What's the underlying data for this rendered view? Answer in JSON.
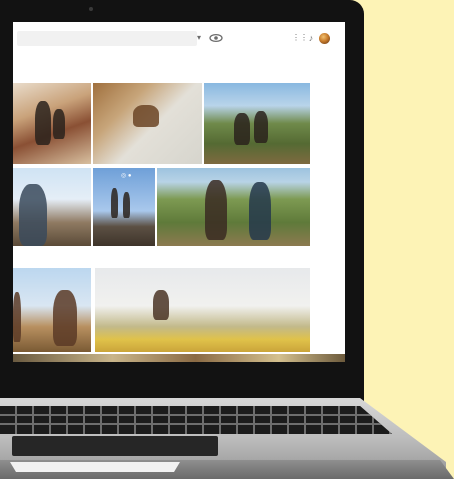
{
  "page": {
    "background": "#fdf3b6",
    "device": "laptop"
  },
  "app": {
    "topbar": {
      "search_placeholder": "",
      "icons": [
        "chevron-down-icon",
        "eye-icon",
        "apps-grid-icon",
        "notifications-icon"
      ],
      "avatar": "user-avatar"
    },
    "photos": [
      {
        "name": "photo-people-posing-rocks"
      },
      {
        "name": "photo-rock-closeup"
      },
      {
        "name": "photo-couple-sitting-hillside"
      },
      {
        "name": "photo-man-pointing-sky"
      },
      {
        "name": "photo-two-people-on-rock"
      },
      {
        "name": "photo-group-celebrating-hill"
      },
      {
        "name": "photo-woman-with-backpack"
      },
      {
        "name": "photo-person-jumping-meadow"
      },
      {
        "name": "photo-bottom-row-partial"
      }
    ],
    "colors": {
      "bezel": "#121212",
      "screen_bg": "#ffffff",
      "search_bg": "#f1f1f1",
      "icon": "#6d6d6d"
    }
  }
}
